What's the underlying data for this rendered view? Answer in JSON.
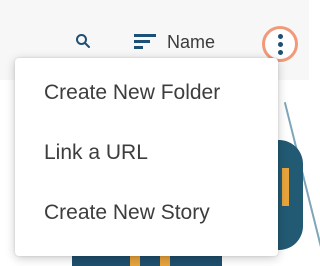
{
  "toolbar": {
    "search_icon": "search-icon",
    "sort_icon": "sort-icon",
    "sort_label": "Name",
    "more_icon": "more-vertical-icon"
  },
  "menu": {
    "items": [
      {
        "label": "Create New Folder"
      },
      {
        "label": "Link a URL"
      },
      {
        "label": "Create New Story"
      }
    ]
  },
  "colors": {
    "highlight_ring": "#f2997a",
    "icon_blue": "#1e4f74",
    "text": "#3d3d3d"
  }
}
